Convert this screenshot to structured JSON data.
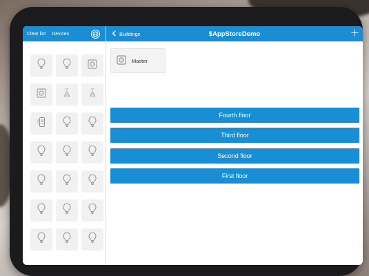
{
  "sidebar": {
    "clear_label": "Clear list",
    "devices_label": "Devices",
    "globe_icon": "globe-icon",
    "tiles": [
      "bulb-icon",
      "bulb-icon",
      "socket-icon",
      "socket-icon",
      "dimmer-icon",
      "dimmer-icon",
      "shutter-icon",
      "bulb-icon",
      "bulb-icon",
      "bulb-icon",
      "bulb-icon",
      "bulb-icon",
      "bulb-icon",
      "bulb-icon",
      "bulb-icon",
      "bulb-icon",
      "bulb-icon",
      "bulb-icon",
      "bulb-icon",
      "bulb-icon",
      "bulb-icon"
    ]
  },
  "header": {
    "back_label": "Buildings",
    "title": "$AppStoreDemo",
    "add_icon": "plus-icon"
  },
  "master": {
    "label": "Master"
  },
  "floors": [
    "Fourth floor",
    "Third floor",
    "Second floor",
    "First floor"
  ],
  "colors": {
    "accent": "#1a8ed4",
    "tile": "#f1f1f1",
    "icon": "#8a8a8a"
  }
}
